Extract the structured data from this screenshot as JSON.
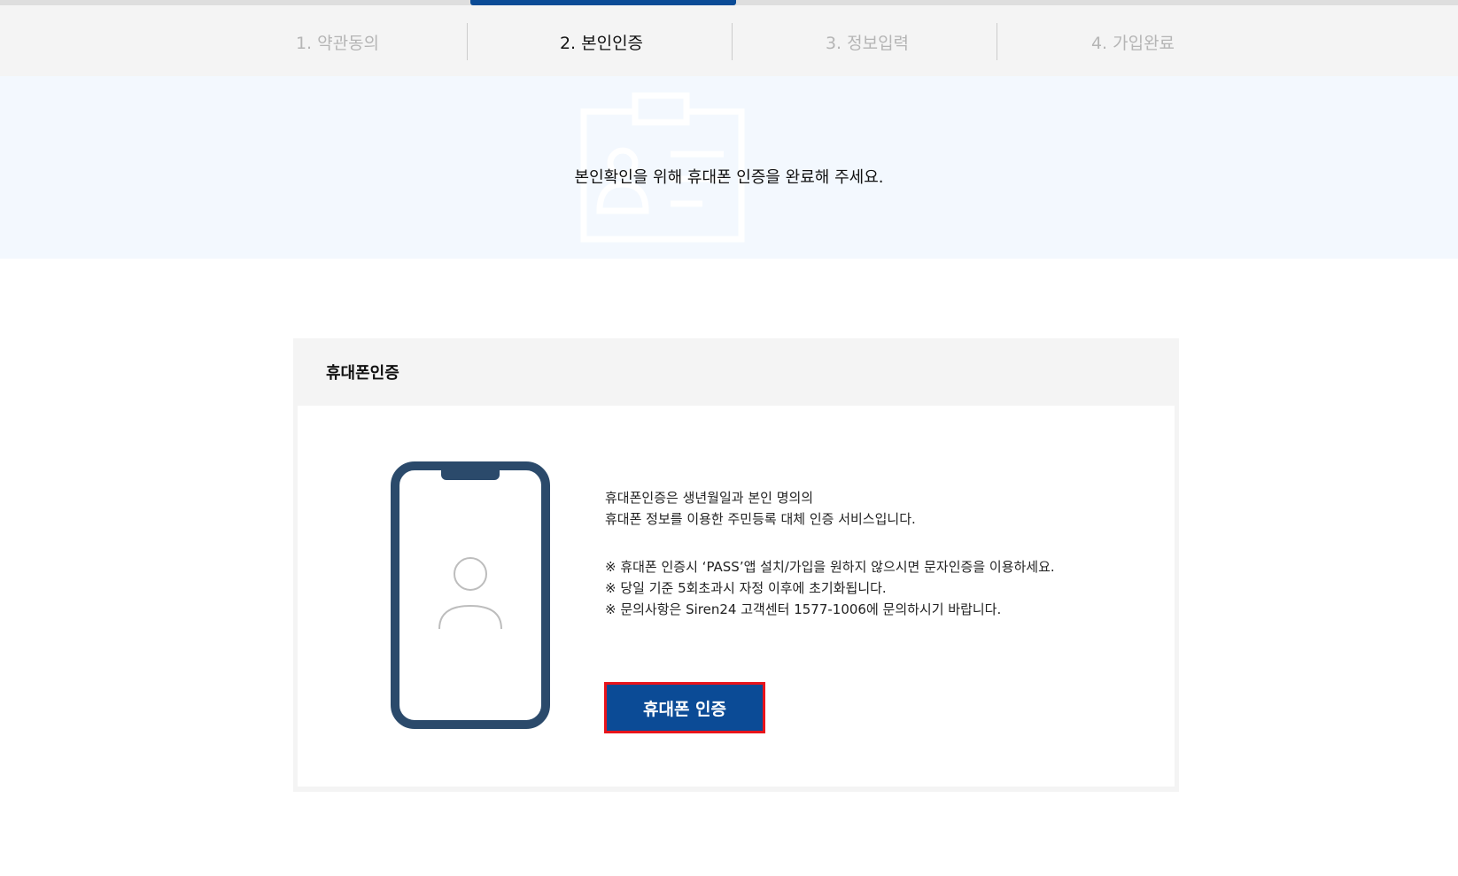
{
  "progress": {
    "step_fraction": 0.5
  },
  "steps": [
    {
      "label": "1. 약관동의",
      "active": false
    },
    {
      "label": "2. 본인인증",
      "active": true
    },
    {
      "label": "3. 정보입력",
      "active": false
    },
    {
      "label": "4. 가입완료",
      "active": false
    }
  ],
  "banner": {
    "message": "본인확인을 위해 휴대폰 인증을 완료해 주세요.",
    "icon": "id-card-icon"
  },
  "card": {
    "title": "휴대폰인증",
    "phone_icon": "smartphone-user-icon",
    "description_lines": [
      "휴대폰인증은 생년월일과 본인 명의의",
      "휴대폰 정보를 이용한 주민등록 대체 인증 서비스입니다."
    ],
    "notes": [
      "※ 휴대폰 인증시 ‘PASS’앱 설치/가입을 원하지 않으시면 문자인증을 이용하세요.",
      "※ 당일 기준 5회초과시 자정 이후에 초기화됩니다.",
      "※ 문의사항은 Siren24 고객센터 1577-1006에 문의하시기 바랍니다."
    ],
    "button_label": "휴대폰 인증"
  },
  "colors": {
    "primary": "#0b4b96",
    "highlight_border": "#e8141b",
    "banner_bg": "#f3f8fe",
    "phone_outline": "#2b4a6b"
  }
}
